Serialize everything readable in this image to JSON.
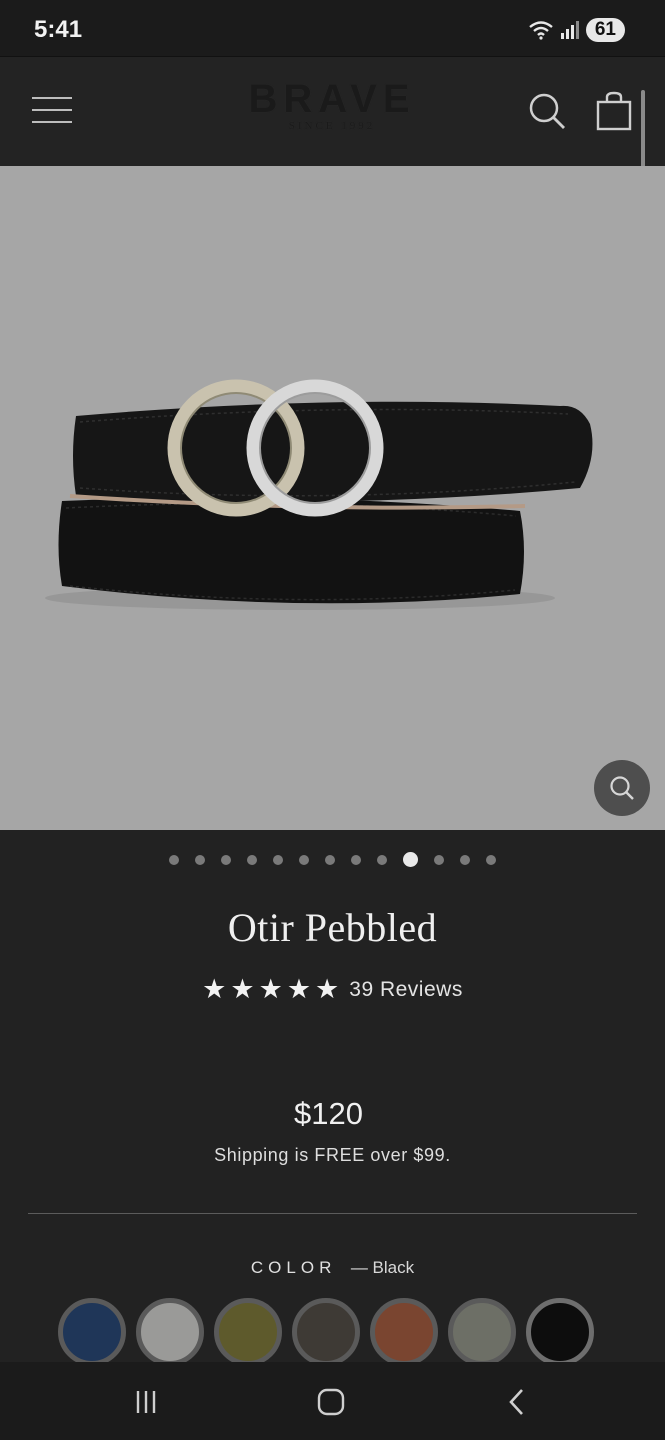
{
  "status_bar": {
    "time": "5:41",
    "battery": "61"
  },
  "header": {
    "logo": "BRAVE",
    "logo_sub": "SINCE 1992"
  },
  "carousel": {
    "dot_count": 13,
    "active_index": 9
  },
  "product": {
    "title": "Otir Pebbled",
    "rating_stars": 5,
    "reviews": "39 Reviews",
    "price": "$120",
    "shipping": "Shipping is FREE over $99."
  },
  "color": {
    "label": "COLOR",
    "selected": "— Black",
    "swatches": [
      {
        "name": "navy",
        "color": "#1f3658"
      },
      {
        "name": "grey",
        "color": "#9a9a98"
      },
      {
        "name": "olive",
        "color": "#5e5a2c"
      },
      {
        "name": "brown",
        "color": "#3e3a35"
      },
      {
        "name": "cognac",
        "color": "#7a4530"
      },
      {
        "name": "sage",
        "color": "#6d6f66"
      },
      {
        "name": "black",
        "color": "#0d0d0d"
      }
    ],
    "selected_index": 6
  },
  "colors": {
    "background": "#222222",
    "image_bg": "#a6a6a6",
    "text": "#efefef"
  }
}
